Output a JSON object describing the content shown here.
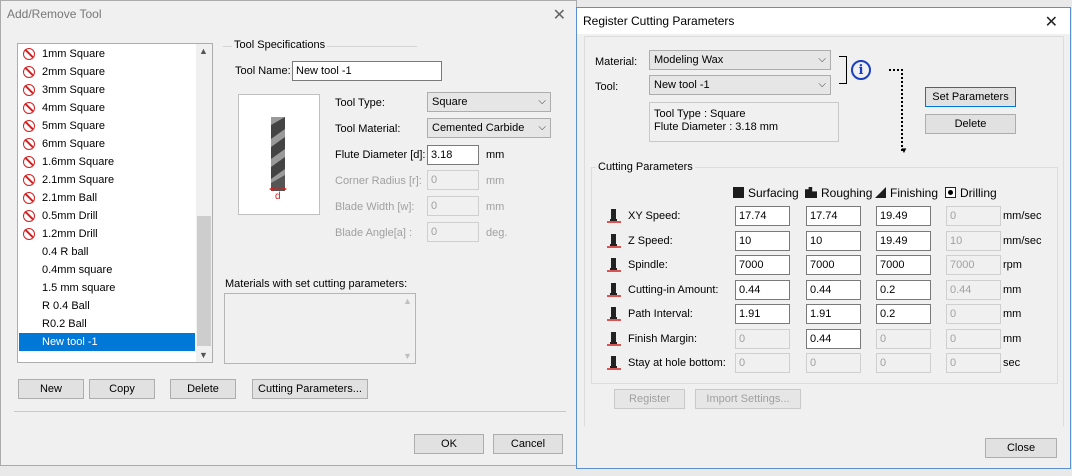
{
  "add_remove": {
    "title": "Add/Remove Tool",
    "tools": [
      {
        "label": "1mm Square",
        "locked": true
      },
      {
        "label": "2mm Square",
        "locked": true
      },
      {
        "label": "3mm Square",
        "locked": true
      },
      {
        "label": "4mm Square",
        "locked": true
      },
      {
        "label": "5mm Square",
        "locked": true
      },
      {
        "label": "6mm Square",
        "locked": true
      },
      {
        "label": "1.6mm Square",
        "locked": true
      },
      {
        "label": "2.1mm Square",
        "locked": true
      },
      {
        "label": "2.1mm Ball",
        "locked": true
      },
      {
        "label": "0.5mm Drill",
        "locked": true
      },
      {
        "label": "1.2mm Drill",
        "locked": true
      },
      {
        "label": "0.4 R ball",
        "locked": false
      },
      {
        "label": "0.4mm square",
        "locked": false
      },
      {
        "label": "1.5 mm square",
        "locked": false
      },
      {
        "label": "R 0.4 Ball",
        "locked": false
      },
      {
        "label": "R0.2 Ball",
        "locked": false
      },
      {
        "label": "New tool -1",
        "locked": false,
        "selected": true
      }
    ],
    "specs": {
      "group_title": "Tool Specifications",
      "tool_name_label": "Tool Name:",
      "tool_name_value": "New tool -1",
      "tool_type_label": "Tool Type:",
      "tool_type_value": "Square",
      "tool_material_label": "Tool Material:",
      "tool_material_value": "Cemented Carbide",
      "flute_label": "Flute Diameter [d]:",
      "flute_value": "3.18",
      "flute_unit": "mm",
      "corner_label": "Corner Radius [r]:",
      "corner_value": "0",
      "corner_unit": "mm",
      "blade_width_label": "Blade Width [w]:",
      "blade_width_value": "0",
      "blade_width_unit": "mm",
      "blade_angle_label": "Blade Angle[a] :",
      "blade_angle_value": "0",
      "blade_angle_unit": "deg.",
      "image_marker": "d"
    },
    "materials_label": "Materials with set cutting parameters:",
    "buttons": {
      "new": "New",
      "copy": "Copy",
      "delete": "Delete",
      "cutting": "Cutting Parameters...",
      "ok": "OK",
      "cancel": "Cancel"
    }
  },
  "register": {
    "title": "Register Cutting Parameters",
    "material_label": "Material:",
    "material_value": "Modeling Wax",
    "tool_label": "Tool:",
    "tool_value": "New tool -1",
    "tool_info_line1": "Tool Type : Square",
    "tool_info_line2": "Flute Diameter : 3.18 mm",
    "set_parameters": "Set Parameters",
    "delete": "Delete",
    "group_title": "Cutting Parameters",
    "columns": [
      "Surfacing",
      "Roughing",
      "Finishing",
      "Drilling"
    ],
    "rows": [
      {
        "label": "XY Speed:",
        "values": [
          "17.74",
          "17.74",
          "19.49",
          "0"
        ],
        "disabled": [
          false,
          false,
          false,
          true
        ],
        "unit": "mm/sec",
        "icon": "xy-speed-icon"
      },
      {
        "label": "Z Speed:",
        "values": [
          "10",
          "10",
          "19.49",
          "10"
        ],
        "disabled": [
          false,
          false,
          false,
          true
        ],
        "unit": "mm/sec",
        "icon": "z-speed-icon"
      },
      {
        "label": "Spindle:",
        "values": [
          "7000",
          "7000",
          "7000",
          "7000"
        ],
        "disabled": [
          false,
          false,
          false,
          true
        ],
        "unit": "rpm",
        "icon": "spindle-icon"
      },
      {
        "label": "Cutting-in Amount:",
        "values": [
          "0.44",
          "0.44",
          "0.2",
          "0.44"
        ],
        "disabled": [
          false,
          false,
          false,
          true
        ],
        "unit": "mm",
        "icon": "cutting-in-icon"
      },
      {
        "label": "Path Interval:",
        "values": [
          "1.91",
          "1.91",
          "0.2",
          "0"
        ],
        "disabled": [
          false,
          false,
          false,
          true
        ],
        "unit": "mm",
        "icon": "path-interval-icon"
      },
      {
        "label": "Finish Margin:",
        "values": [
          "0",
          "0.44",
          "0",
          "0"
        ],
        "disabled": [
          true,
          false,
          true,
          true
        ],
        "unit": "mm",
        "icon": "finish-margin-icon"
      },
      {
        "label": "Stay at hole bottom:",
        "values": [
          "0",
          "0",
          "0",
          "0"
        ],
        "disabled": [
          true,
          true,
          true,
          true
        ],
        "unit": "sec",
        "icon": "stay-hole-icon"
      }
    ],
    "register_btn": "Register",
    "import_btn": "Import Settings...",
    "close_btn": "Close"
  }
}
